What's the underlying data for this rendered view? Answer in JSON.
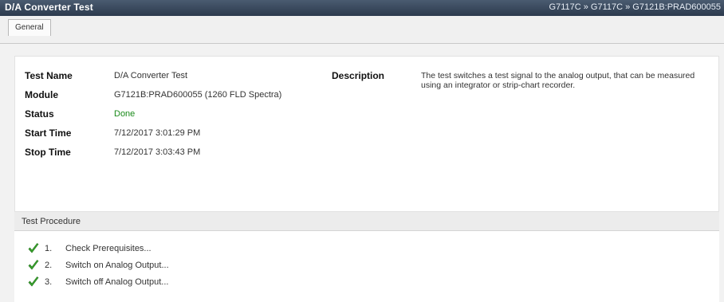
{
  "window": {
    "title": "D/A Converter Test",
    "path": "G7117C » G7117C » G7121B:PRAD600055"
  },
  "tabs": [
    {
      "label": "General"
    }
  ],
  "info": {
    "test_name_label": "Test Name",
    "test_name_value": "D/A Converter Test",
    "module_label": "Module",
    "module_value": "G7121B:PRAD600055 (1260 FLD Spectra)",
    "status_label": "Status",
    "status_value": "Done",
    "start_label": "Start Time",
    "start_value": "7/12/2017 3:01:29 PM",
    "stop_label": "Stop Time",
    "stop_value": "7/12/2017 3:03:43 PM",
    "description_label": "Description",
    "description_text": "The test switches a test signal to the analog output, that can be measured using an integrator or strip-chart recorder."
  },
  "procedure": {
    "header": "Test Procedure",
    "steps": [
      {
        "num": "1.",
        "name": "Check Prerequisites...",
        "icon": "checkmark-icon"
      },
      {
        "num": "2.",
        "name": "Switch on Analog Output...",
        "icon": "checkmark-icon"
      },
      {
        "num": "3.",
        "name": "Switch off Analog Output...",
        "icon": "checkmark-icon"
      }
    ]
  },
  "colors": {
    "titlebar": "#2c3a4d",
    "status_done": "#1a8a1a",
    "check_green": "#3aa82e"
  }
}
